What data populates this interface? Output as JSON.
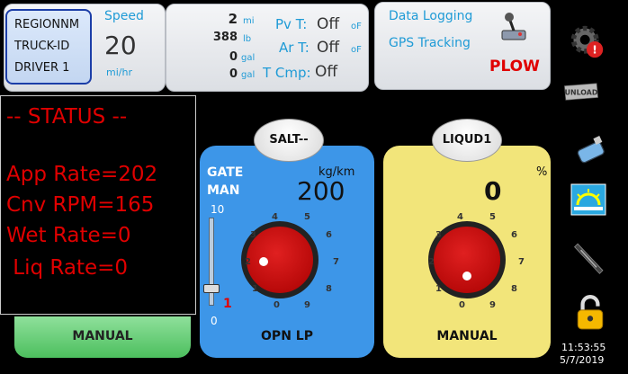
{
  "id_box": {
    "region": "REGIONNM",
    "truck": "TRUCK-ID",
    "driver": "DRIVER 1"
  },
  "speed": {
    "label": "Speed",
    "value": "20",
    "unit": "mi/hr"
  },
  "totals": [
    {
      "value": "2",
      "unit": "mi"
    },
    {
      "value": "388",
      "unit": "lb"
    },
    {
      "value": "0",
      "unit": "gal"
    },
    {
      "value": "0",
      "unit": "gal"
    }
  ],
  "temps": {
    "pv_label": "Pv T:",
    "pv_value": "Off",
    "pv_unit": "oF",
    "ar_label": "Ar T:",
    "ar_value": "Off",
    "ar_unit": "oF",
    "cmp_label": "T Cmp:",
    "cmp_value": "Off"
  },
  "right_card": {
    "data_logging": "Data Logging",
    "gps": "GPS Tracking",
    "plow": "PLOW"
  },
  "status": {
    "title": "-- STATUS --",
    "app_rate": "App Rate=202",
    "cnv_rpm": "Cnv RPM=165",
    "wet_rate": "Wet Rate=0",
    "liq_rate": " Liq Rate=0"
  },
  "salt": {
    "label": "SALT--",
    "gate": "GATE",
    "man": "MAN",
    "unit": "kg/km",
    "value": "200",
    "slider_top": "10",
    "slider_bottom": "0",
    "slider_value": "1",
    "knob_ticks": [
      "0",
      "1",
      "2",
      "3",
      "4",
      "5",
      "6",
      "7",
      "8",
      "9"
    ],
    "button": "OPN LP",
    "knob_level": 0.0
  },
  "liquid": {
    "label": "LIQUD1",
    "unit": "%",
    "value": "0",
    "knob_ticks": [
      "0",
      "1",
      "2",
      "3",
      "4",
      "5",
      "6",
      "7",
      "8",
      "9"
    ],
    "button": "MANUAL",
    "knob_level": 0.0
  },
  "left_button": "MANUAL",
  "clock": {
    "time": "11:53:55",
    "date": "5/7/2019"
  },
  "icons": [
    "gear-alert-icon",
    "unload-icon",
    "usb-drive-icon",
    "brightness-icon",
    "plow-blade-icon",
    "lock-icon",
    "joystick-icon"
  ],
  "colors": {
    "salt_panel": "#3d96e8",
    "liquid_panel": "#f2e57a",
    "knob": "#c00000",
    "status_text": "#e00000",
    "manual_button": "#6bd07a",
    "accent": "#1f9bd6",
    "plow": "#e00000"
  }
}
